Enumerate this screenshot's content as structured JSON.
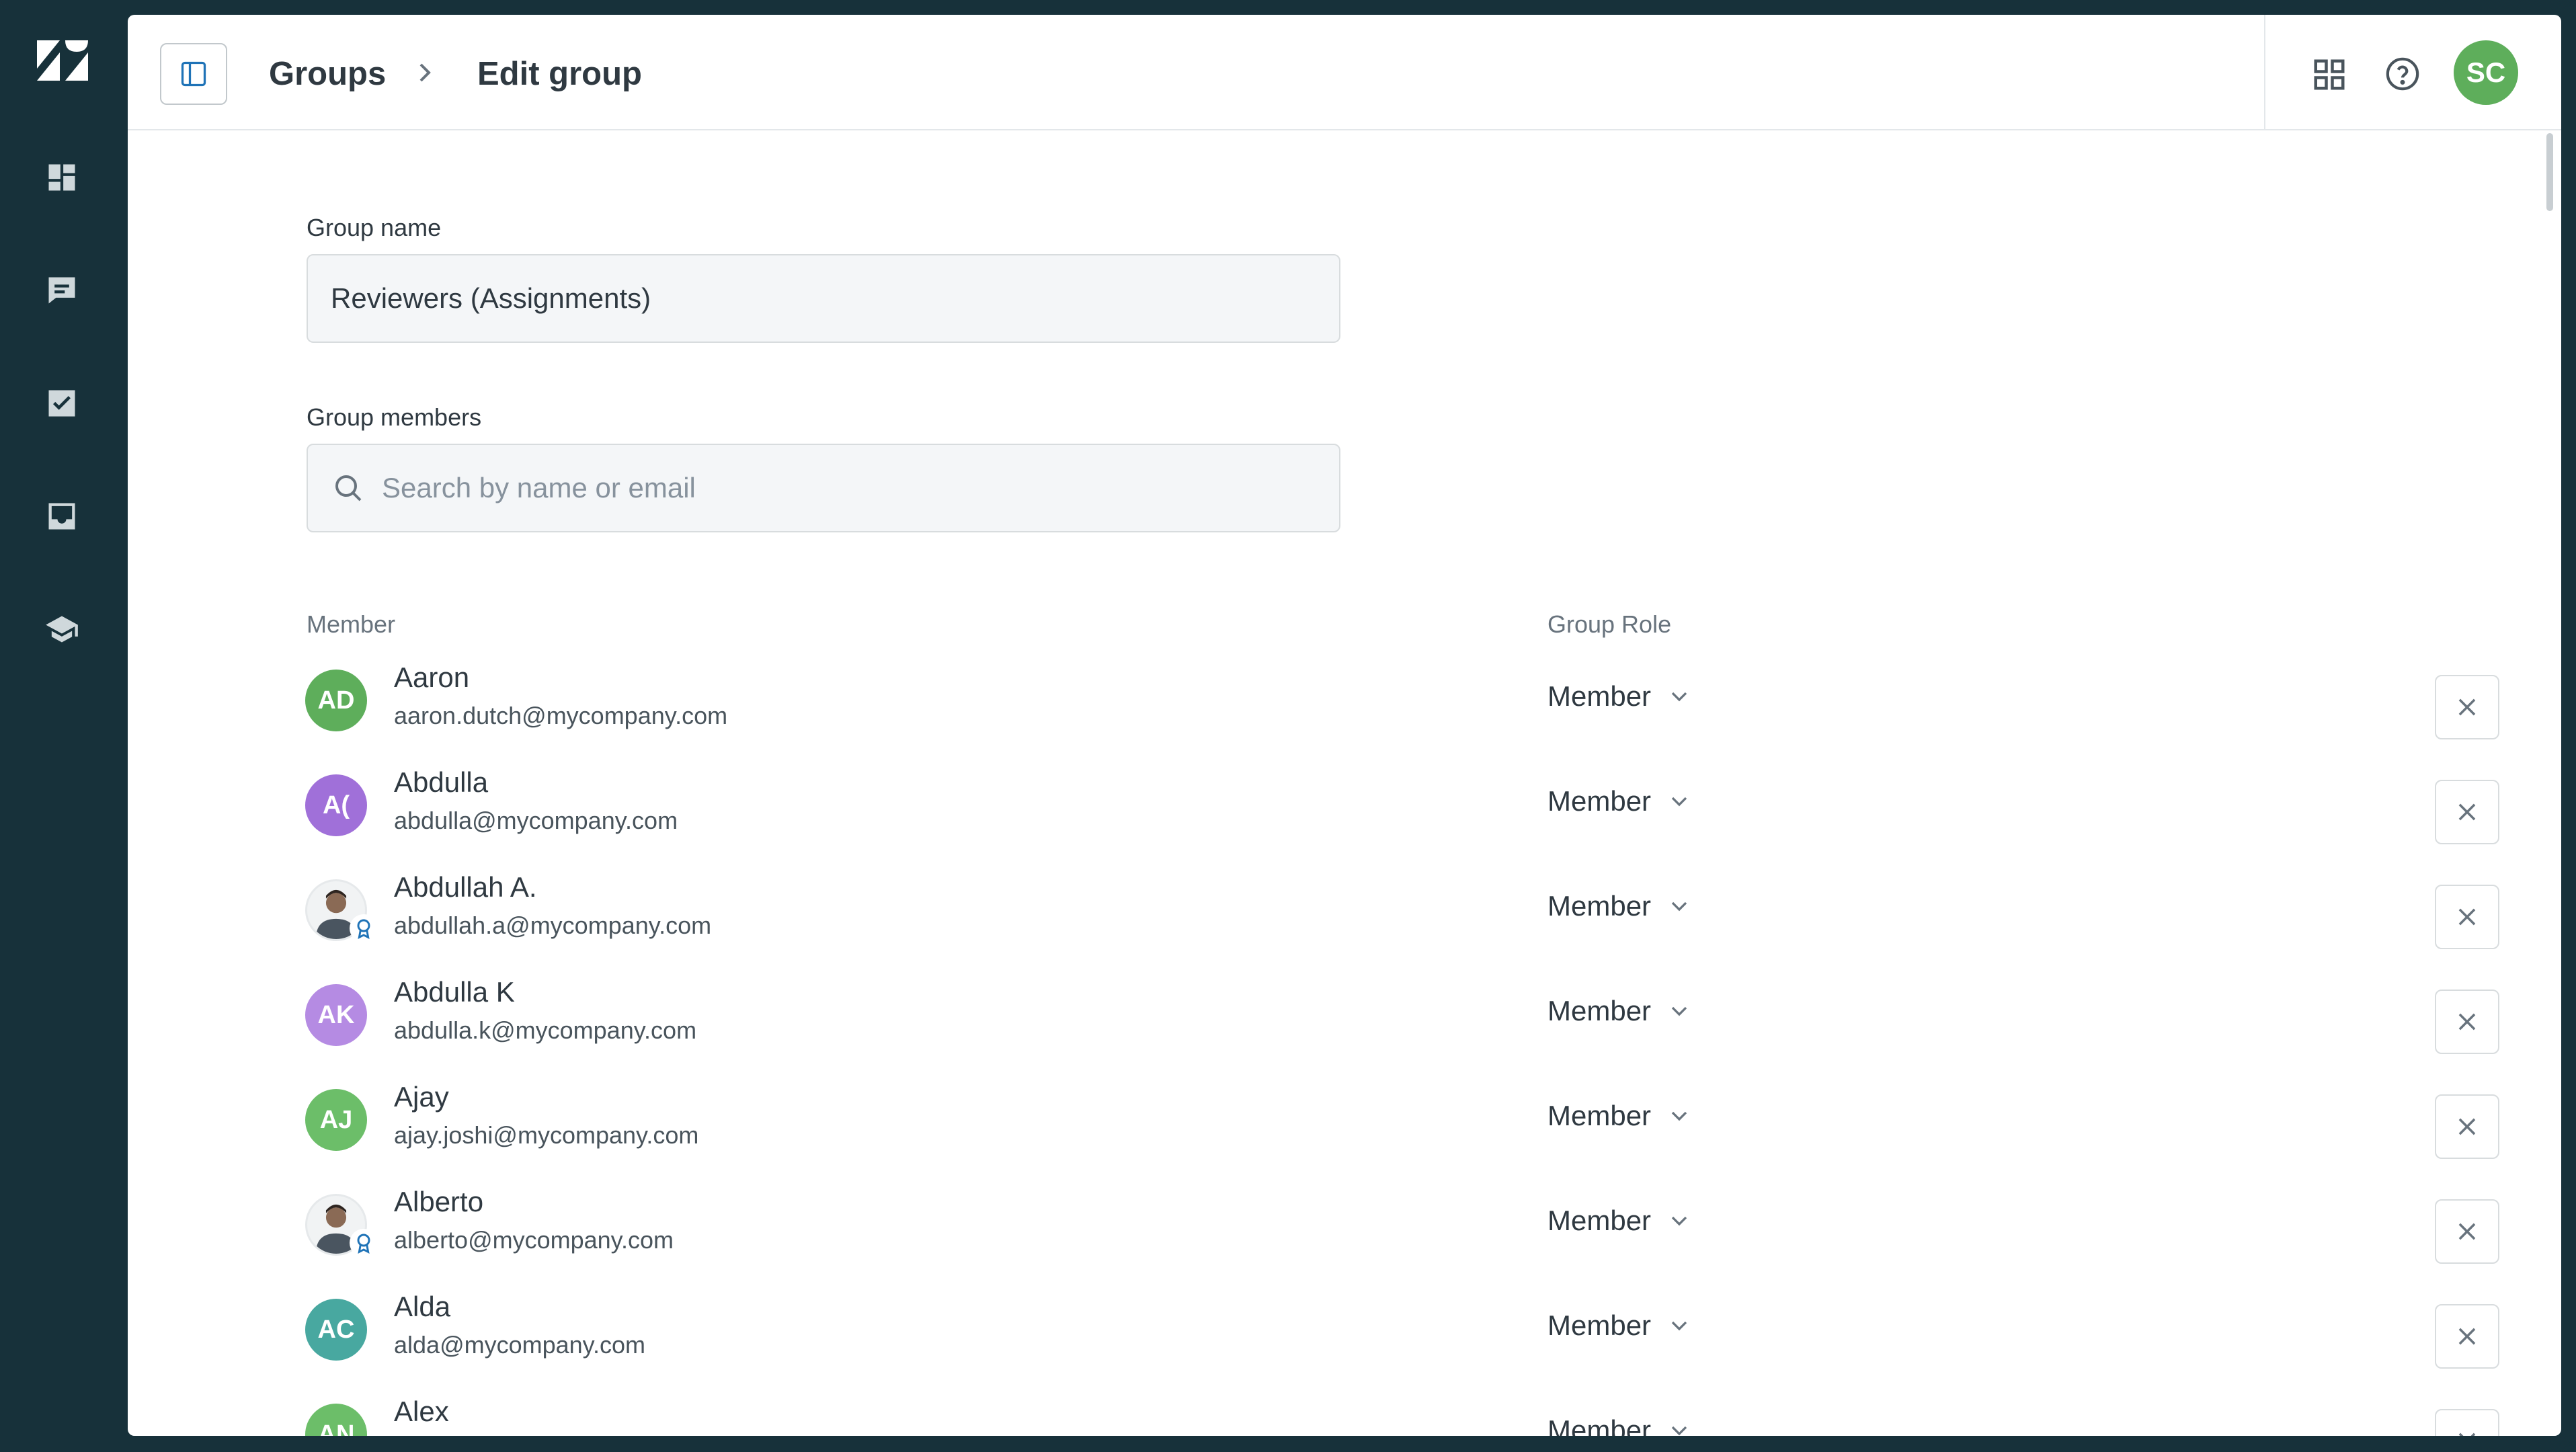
{
  "nav": {
    "items": [
      "dashboard-icon",
      "conversations-icon",
      "tasks-icon",
      "inbox-icon",
      "learning-icon"
    ]
  },
  "breadcrumb": {
    "parent": "Groups",
    "current": "Edit group"
  },
  "header": {
    "user_initials": "SC"
  },
  "form": {
    "group_name_label": "Group name",
    "group_name_value": "Reviewers (Assignments)",
    "members_label": "Group members",
    "search_placeholder": "Search by name or email"
  },
  "table": {
    "col_member": "Member",
    "col_role": "Group Role",
    "rows": [
      {
        "initials": "AD",
        "color": "#5eae5b",
        "name": "Aaron",
        "email": "aaron.dutch@mycompany.com",
        "role": "Member"
      },
      {
        "initials": "A(",
        "color": "#a070d9",
        "name": "Abdulla",
        "email": "abdulla@mycompany.com",
        "role": "Member"
      },
      {
        "initials": "",
        "color": "#f1f3f4",
        "name": "Abdullah A.",
        "email": "abdullah.a@mycompany.com",
        "role": "Member"
      },
      {
        "initials": "AK",
        "color": "#b58be3",
        "name": "Abdulla K",
        "email": "abdulla.k@mycompany.com",
        "role": "Member"
      },
      {
        "initials": "AJ",
        "color": "#6cbe69",
        "name": "Ajay",
        "email": "ajay.joshi@mycompany.com",
        "role": "Member"
      },
      {
        "initials": "",
        "color": "#f1f3f4",
        "name": "Alberto",
        "email": "alberto@mycompany.com",
        "role": "Member"
      },
      {
        "initials": "AC",
        "color": "#48a8a0",
        "name": "Alda",
        "email": "alda@mycompany.com",
        "role": "Member"
      },
      {
        "initials": "AN",
        "color": "#6cbe69",
        "name": "Alex",
        "email": "",
        "role": "Member"
      }
    ]
  },
  "colors": {
    "rail": "#17313a",
    "accent": "#1f73b7"
  }
}
